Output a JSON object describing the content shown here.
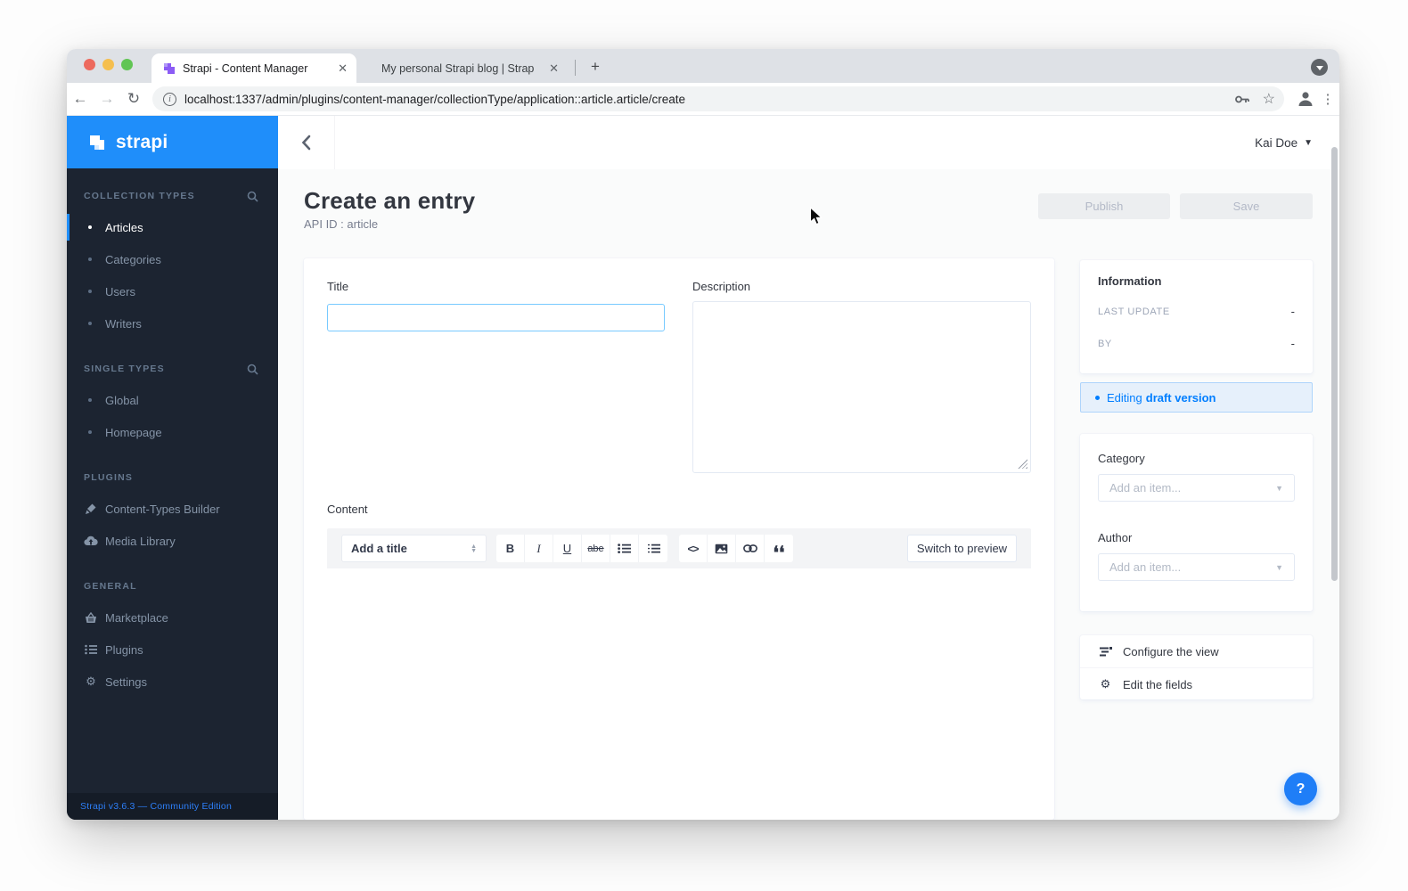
{
  "window": {
    "tabs": [
      {
        "title": "Strapi - Content Manager"
      },
      {
        "title": "My personal Strapi blog | Strap"
      }
    ],
    "new_tab": "+",
    "url": "localhost:1337/admin/plugins/content-manager/collectionType/application::article.article/create"
  },
  "sidebar": {
    "logo_text": "strapi",
    "sections": [
      {
        "heading": "COLLECTION TYPES",
        "items": [
          {
            "label": "Articles"
          },
          {
            "label": "Categories"
          },
          {
            "label": "Users"
          },
          {
            "label": "Writers"
          }
        ]
      },
      {
        "heading": "SINGLE TYPES",
        "items": [
          {
            "label": "Global"
          },
          {
            "label": "Homepage"
          }
        ]
      },
      {
        "heading": "PLUGINS",
        "items": [
          {
            "label": "Content-Types Builder"
          },
          {
            "label": "Media Library"
          }
        ]
      },
      {
        "heading": "GENERAL",
        "items": [
          {
            "label": "Marketplace"
          },
          {
            "label": "Plugins"
          },
          {
            "label": "Settings"
          }
        ]
      }
    ],
    "footer": "Strapi v3.6.3 — Community Edition"
  },
  "header": {
    "user": "Kai Doe"
  },
  "page": {
    "title": "Create an entry",
    "subtitle": "API ID : article",
    "publish_label": "Publish",
    "save_label": "Save"
  },
  "form": {
    "title_label": "Title",
    "description_label": "Description",
    "content_label": "Content",
    "editor": {
      "heading_select": "Add a title",
      "bold": "B",
      "italic": "I",
      "underline": "U",
      "strike": "abe",
      "code": "<>",
      "preview_label": "Switch to preview"
    }
  },
  "panel": {
    "information": {
      "title": "Information",
      "last_update_label": "LAST UPDATE",
      "last_update_value": "-",
      "by_label": "BY",
      "by_value": "-"
    },
    "draft_prefix": "Editing",
    "draft_bold": "draft version",
    "category": {
      "label": "Category",
      "placeholder": "Add an item..."
    },
    "author": {
      "label": "Author",
      "placeholder": "Add an item..."
    },
    "links": [
      {
        "label": "Configure the view"
      },
      {
        "label": "Edit the fields"
      }
    ]
  },
  "help_label": "?",
  "colors": {
    "accent_blue": "#1f8efa",
    "strapi_blue": "#007eff",
    "sidebar_bg": "#1c2431",
    "draft_bg": "#e6f0fb"
  }
}
